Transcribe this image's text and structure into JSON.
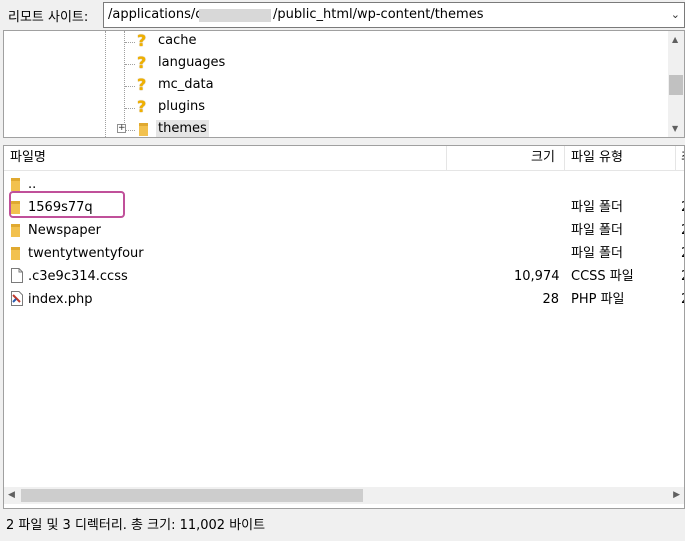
{
  "address": {
    "label": "리모트 사이트:",
    "path_start": "/applications/c",
    "path_end": "/public_html/wp-content/themes"
  },
  "tree": {
    "items": [
      {
        "label": "cache",
        "icon": "question-folder-icon"
      },
      {
        "label": "languages",
        "icon": "question-folder-icon"
      },
      {
        "label": "mc_data",
        "icon": "question-folder-icon"
      },
      {
        "label": "plugins",
        "icon": "question-folder-icon"
      },
      {
        "label": "themes",
        "icon": "folder-icon",
        "selected": true,
        "expander": "+"
      }
    ]
  },
  "list": {
    "columns": {
      "name": "파일명",
      "size": "크기",
      "type": "파일 유형",
      "extra": "최"
    },
    "rows": [
      {
        "name": "..",
        "size": "",
        "type": "",
        "icon": "folder-icon"
      },
      {
        "name": "1569s77q",
        "size": "",
        "type": "파일 폴더",
        "extra": "2",
        "icon": "folder-icon"
      },
      {
        "name": "Newspaper",
        "size": "",
        "type": "파일 폴더",
        "extra": "2",
        "icon": "folder-icon"
      },
      {
        "name": "twentytwentyfour",
        "size": "",
        "type": "파일 폴더",
        "extra": "2",
        "icon": "folder-icon"
      },
      {
        "name": ".c3e9c314.ccss",
        "size": "10,974",
        "type": "CCSS 파일",
        "extra": "2",
        "icon": "file-icon"
      },
      {
        "name": "index.php",
        "size": "28",
        "type": "PHP 파일",
        "extra": "2",
        "icon": "php-file-icon"
      }
    ]
  },
  "status": {
    "text": "2 파일 및 3 디렉터리. 총 크기: 11,002 바이트"
  },
  "colors": {
    "highlight": "#c0509a",
    "folder": "#f2c14e"
  }
}
